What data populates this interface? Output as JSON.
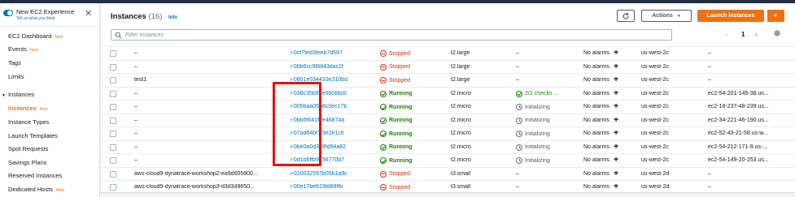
{
  "sidebar": {
    "experience_title": "New EC2 Experience",
    "experience_subtitle": "Tell us what you think",
    "new_badge": "New",
    "items": {
      "dashboard": "EC2 Dashboard",
      "events": "Events",
      "tags": "Tags",
      "limits": "Limits",
      "instances_section": "Instances",
      "instances": "Instances",
      "instance_types": "Instance Types",
      "launch_templates": "Launch Templates",
      "spot_requests": "Spot Requests",
      "savings_plans": "Savings Plans",
      "reserved_instances": "Reserved Instances",
      "dedicated_hosts": "Dedicated Hosts"
    }
  },
  "header": {
    "title": "Instances",
    "count": "(16)",
    "info_link": "Info",
    "actions_label": "Actions",
    "launch_label": "Launch instances"
  },
  "filter": {
    "placeholder": "Filter instances"
  },
  "pagination": {
    "current_page": "1",
    "prev": "‹",
    "next": "›"
  },
  "table": {
    "rows": [
      {
        "name": "–",
        "id": "i-0cf7fed3feeb7d597",
        "state": "Stopped",
        "type": "t2.large",
        "check": "–",
        "alarm": "No alarms",
        "az": "us-west-2c",
        "dns": "–"
      },
      {
        "name": "–",
        "id": "i-00b6cc9f8843dac2f",
        "state": "Stopped",
        "type": "t2.large",
        "check": "–",
        "alarm": "No alarms",
        "az": "us-west-2c",
        "dns": "–"
      },
      {
        "name": "test1",
        "id": "i-0801e034433e310bd",
        "state": "Stopped",
        "type": "t2.large",
        "check": "–",
        "alarm": "No alarms",
        "az": "us-west-2c",
        "dns": "–"
      },
      {
        "name": "–",
        "id": "i-038c35b9de08c6bcb",
        "state": "Running",
        "type": "t2.micro",
        "check": "2/2 checks ...",
        "alarm": "No alarms",
        "az": "us-west-2c",
        "dns": "ec2-54-201-145-38.us..."
      },
      {
        "name": "–",
        "id": "i-005baa05b8c0ec17b",
        "state": "Running",
        "type": "t2.micro",
        "check": "Initializing",
        "alarm": "No alarms",
        "az": "us-west-2c",
        "dns": "ec2-18-237-48-239.us..."
      },
      {
        "name": "–",
        "id": "i-0bb6f641f2e46874a",
        "state": "Running",
        "type": "t2.micro",
        "check": "Initializing",
        "alarm": "No alarms",
        "az": "us-west-2c",
        "dns": "ec2-34-221-46-190.us..."
      },
      {
        "name": "–",
        "id": "i-07ad64bf1f3e2e1c6",
        "state": "Running",
        "type": "t2.micro",
        "check": "Initializing",
        "alarm": "No alarms",
        "az": "us-west-2c",
        "dns": "ec2-52-43-21-58.us-w..."
      },
      {
        "name": "–",
        "id": "i-0be0a0d328fd94a82",
        "state": "Running",
        "type": "t2.micro",
        "check": "Initializing",
        "alarm": "No alarms",
        "az": "us-west-2c",
        "dns": "ec2-54-212-171-9.us-..."
      },
      {
        "name": "–",
        "id": "i-0d1b6ffb9756770b7",
        "state": "Running",
        "type": "t2.micro",
        "check": "Initializing",
        "alarm": "No alarms",
        "az": "us-west-2c",
        "dns": "ec2-54-149-20-253.us..."
      },
      {
        "name": "aws-cloud9-dynatrace-workshop2-ea9d605800...",
        "id": "i-020032597b05b1a9c",
        "state": "Stopped",
        "type": "t3.small",
        "check": "–",
        "alarm": "No alarms",
        "az": "us-west-2d",
        "dns": "–"
      },
      {
        "name": "aws-cloud9-dynatrace-workshop3-d3d349650...",
        "id": "i-00e17be619fd89ffb",
        "state": "Stopped",
        "type": "t3.small",
        "check": "–",
        "alarm": "No alarms",
        "az": "us-west-2d",
        "dns": "–"
      }
    ]
  },
  "colors": {
    "accent_orange": "#ec7211",
    "link_blue": "#0073bb",
    "running_green": "#1d8102",
    "stopped_red": "#d13212",
    "highlight_red": "#e8120c"
  }
}
